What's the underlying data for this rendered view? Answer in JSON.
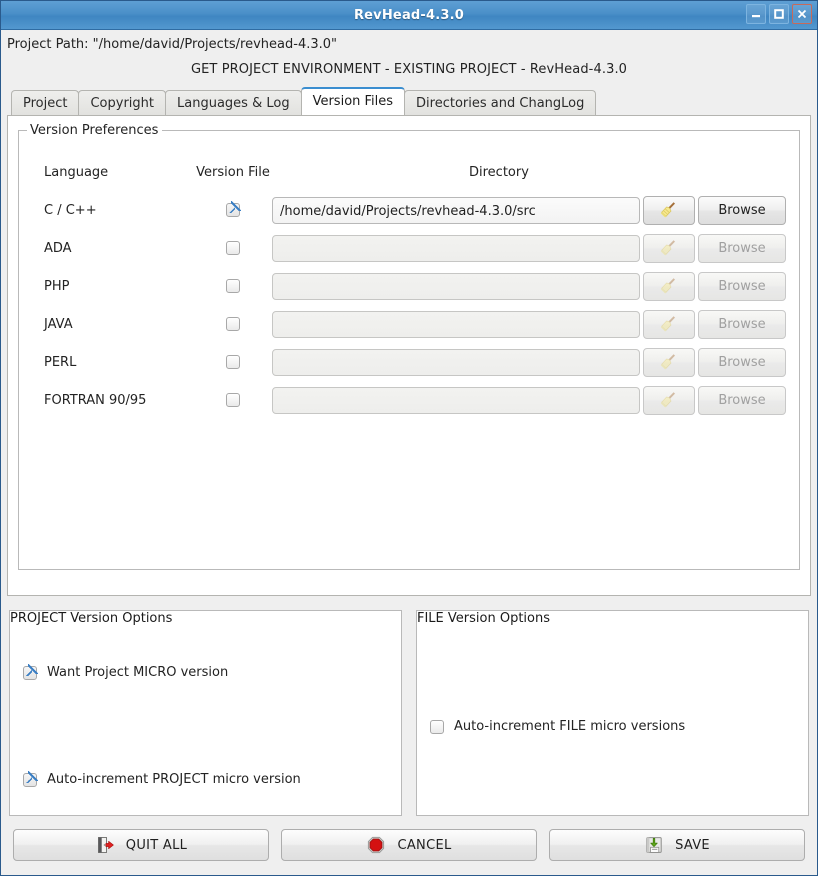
{
  "window": {
    "title": "RevHead-4.3.0",
    "controls": [
      {
        "name": "minimize-button",
        "glyph": "minimize-icon"
      },
      {
        "name": "maximize-button",
        "glyph": "maximize-icon"
      },
      {
        "name": "close-button",
        "glyph": "close-icon"
      }
    ]
  },
  "header": {
    "project_path": "Project Path: \"/home/david/Projects/revhead-4.3.0\"",
    "screen_title": "GET PROJECT ENVIRONMENT - EXISTING PROJECT - RevHead-4.3.0"
  },
  "tabs": [
    {
      "label": "Project",
      "active": false
    },
    {
      "label": "Copyright",
      "active": false
    },
    {
      "label": "Languages & Log",
      "active": false
    },
    {
      "label": "Version Files",
      "active": true
    },
    {
      "label": "Directories and ChangLog",
      "active": false
    }
  ],
  "version_preferences": {
    "group_title": "Version Preferences",
    "columns": {
      "language": "Language",
      "version_file": "Version File",
      "directory": "Directory"
    },
    "broom_button_label": "",
    "browse_button_label": "Browse",
    "rows": [
      {
        "language": "C / C++",
        "checked": true,
        "enabled": true,
        "directory": "/home/david/Projects/revhead-4.3.0/src"
      },
      {
        "language": "ADA",
        "checked": false,
        "enabled": false,
        "directory": ""
      },
      {
        "language": "PHP",
        "checked": false,
        "enabled": false,
        "directory": ""
      },
      {
        "language": "JAVA",
        "checked": false,
        "enabled": false,
        "directory": ""
      },
      {
        "language": "PERL",
        "checked": false,
        "enabled": false,
        "directory": ""
      },
      {
        "language": "FORTRAN 90/95",
        "checked": false,
        "enabled": false,
        "directory": ""
      }
    ]
  },
  "project_version_options": {
    "group_title": "PROJECT Version Options",
    "items": [
      {
        "label": "Want Project MICRO version",
        "checked": true
      },
      {
        "label": "Auto-increment PROJECT micro version",
        "checked": true
      }
    ]
  },
  "file_version_options": {
    "group_title": "FILE Version Options",
    "items": [
      {
        "label": "Auto-increment FILE micro versions",
        "checked": false
      }
    ]
  },
  "buttons": {
    "quit": {
      "label": "QUIT ALL",
      "icon": "exit-door-icon"
    },
    "cancel": {
      "label": "CANCEL",
      "icon": "stop-octagon-icon"
    },
    "save": {
      "label": "SAVE",
      "icon": "floppy-save-icon"
    }
  },
  "colors": {
    "titlebar_blue": "#4a8fc8",
    "active_tab_accent": "#3b8ed0",
    "checkbox_check": "#3b7fc4",
    "cancel_red": "#d41111",
    "save_green": "#5ea819",
    "broom_yellow": "#f5e27a"
  }
}
